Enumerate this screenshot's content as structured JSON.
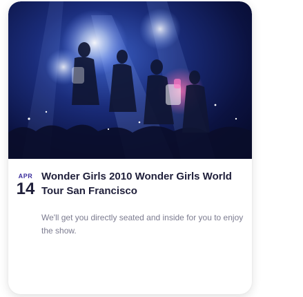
{
  "event": {
    "image_alt": "Wonder Girls performing on stage",
    "date": {
      "month": "APR",
      "day": "14"
    },
    "title": "Wonder Girls 2010 Wonder Girls World Tour San Francisco",
    "description": "We'll get you directly seated and inside for you to enjoy the show."
  },
  "colors": {
    "month_accent": "#3a2d9c",
    "title_text": "#1f1f3a",
    "description_text": "#7b7b8f"
  }
}
